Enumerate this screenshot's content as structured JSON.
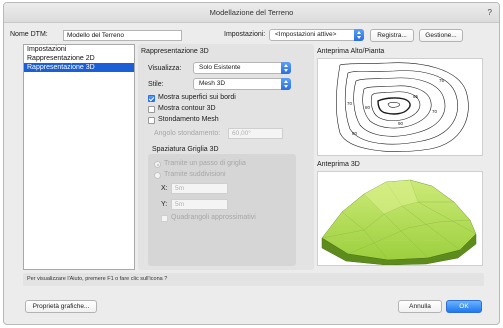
{
  "window": {
    "title": "Modellazione del Terreno",
    "help": "?"
  },
  "header": {
    "dtm_name_label": "Nome DTM:",
    "dtm_name_value": "Modello del Terreno",
    "settings_label": "Impostazioni:",
    "settings_value": "<Impostazioni attive>",
    "save_button": "Registra...",
    "manage_button": "Gestione..."
  },
  "sidebar": {
    "items": [
      {
        "label": "Impostazioni",
        "selected": false
      },
      {
        "label": "Rappresentazione 2D",
        "selected": false
      },
      {
        "label": "Rappresentazione 3D",
        "selected": true
      }
    ]
  },
  "main": {
    "section_title": "Rappresentazione 3D",
    "display_label": "Visualizza:",
    "display_value": "Solo Esistente",
    "style_label": "Stile:",
    "style_value": "Mesh 3D",
    "show_surfaces_label": "Mostra superfici sui bordi",
    "show_surfaces_checked": true,
    "show_contour_label": "Mostra contour 3D",
    "show_contour_checked": false,
    "smoothing_label": "Stondamento Mesh",
    "smoothing_checked": false,
    "smoothing_angle_label": "Angolo stondamento:",
    "smoothing_angle_value": "60,00°",
    "grid_title": "Spaziatura Griglia 3D",
    "radio_step_label": "Tramite un passo di griglia",
    "radio_subdiv_label": "Tramite suddivisioni",
    "x_label": "X:",
    "x_value": "5m",
    "y_label": "Y:",
    "y_value": "5m",
    "approx_quads_label": "Quadrangoli approssimativi"
  },
  "previews": {
    "top_title": "Anteprima Alto/Pianta",
    "view3d_title": "Anteprima 3D",
    "contour_labels": [
      "75",
      "70",
      "70",
      "80",
      "85",
      "90",
      "80"
    ]
  },
  "status_text": "Per visualizzare l'Aiuto, premere F1 o fare clic sull'icona ?",
  "footer": {
    "graphic_props_button": "Proprietà grafiche...",
    "cancel_button": "Annulla",
    "ok_button": "OK"
  },
  "colors": {
    "accent": "#1d78f2",
    "terrain_light": "#b8e05a",
    "terrain_dark": "#5f8f1e",
    "selection": "#1a5fd6"
  }
}
